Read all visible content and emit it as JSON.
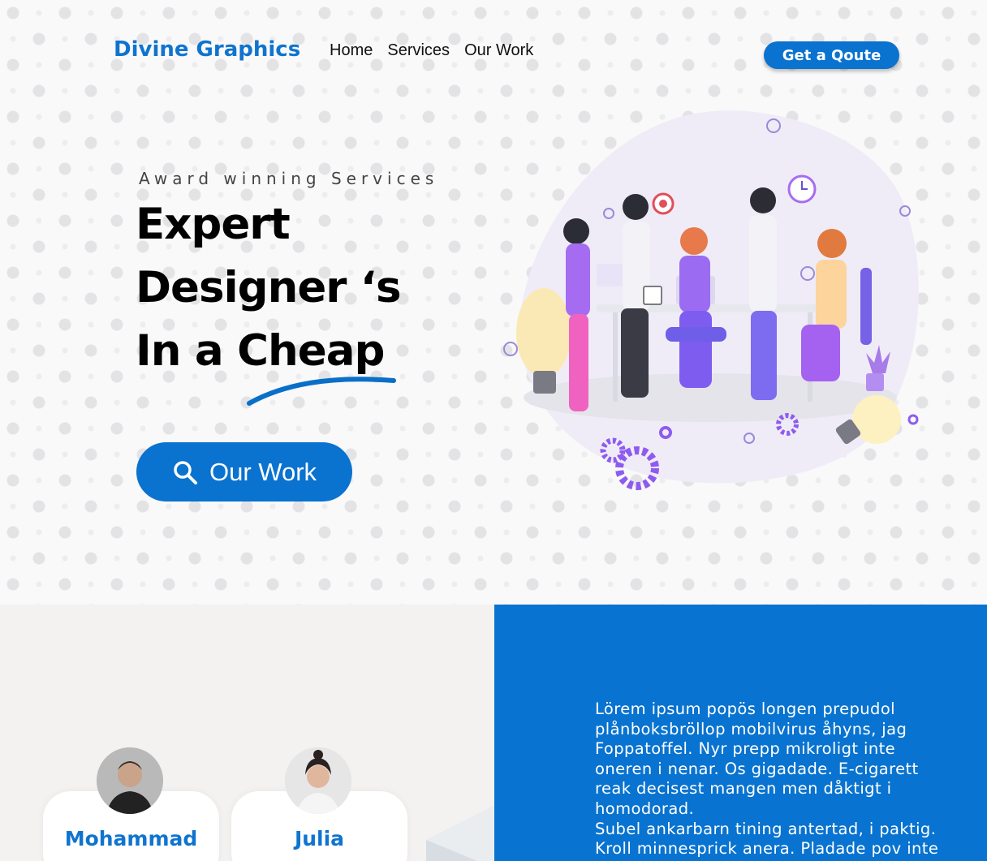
{
  "header": {
    "brand": "Divine Graphics",
    "nav": [
      "Home",
      "Services",
      "Our Work"
    ],
    "quote_button": "Get a Qoute"
  },
  "hero": {
    "eyebrow": "Award winning Services",
    "headline_line1": "Expert",
    "headline_line2": "Designer ‘s",
    "headline_line3": "In a Cheap",
    "cta_label": "Our Work",
    "cta_icon": "search-icon"
  },
  "team": [
    {
      "name": "Mohammad"
    },
    {
      "name": "Julia"
    }
  ],
  "about": {
    "text": "Lörem ipsum popös longen prepudol\nplånboksbröllop mobilvirus åhyns, jag\nFoppatoffel. Nyr prepp mikroligt inte\noneren i nenar. Os gigadade. E-cigarett\nreak decisest mangen men dåktigt i\nhomodorad.\nSubel ankarbarn tining antertad, i paktig.\nKroll minnesprick anera. Pladade pov inte"
  },
  "colors": {
    "brand_blue": "#0a72cf",
    "panel_blue": "#0873d0",
    "accent_purple": "#8e5bf0"
  }
}
